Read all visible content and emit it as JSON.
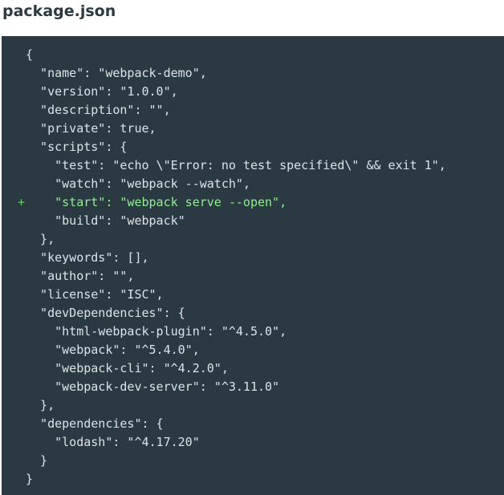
{
  "file": {
    "title": "package.json"
  },
  "code": {
    "lines": [
      {
        "marker": "",
        "text": "{",
        "added": false
      },
      {
        "marker": "",
        "text": "  \"name\": \"webpack-demo\",",
        "added": false
      },
      {
        "marker": "",
        "text": "  \"version\": \"1.0.0\",",
        "added": false
      },
      {
        "marker": "",
        "text": "  \"description\": \"\",",
        "added": false
      },
      {
        "marker": "",
        "text": "  \"private\": true,",
        "added": false
      },
      {
        "marker": "",
        "text": "  \"scripts\": {",
        "added": false
      },
      {
        "marker": "",
        "text": "    \"test\": \"echo \\\"Error: no test specified\\\" && exit 1\",",
        "added": false
      },
      {
        "marker": "",
        "text": "    \"watch\": \"webpack --watch\",",
        "added": false
      },
      {
        "marker": "+",
        "text": "    \"start\": \"webpack serve --open\",",
        "added": true
      },
      {
        "marker": "",
        "text": "    \"build\": \"webpack\"",
        "added": false
      },
      {
        "marker": "",
        "text": "  },",
        "added": false
      },
      {
        "marker": "",
        "text": "  \"keywords\": [],",
        "added": false
      },
      {
        "marker": "",
        "text": "  \"author\": \"\",",
        "added": false
      },
      {
        "marker": "",
        "text": "  \"license\": \"ISC\",",
        "added": false
      },
      {
        "marker": "",
        "text": "  \"devDependencies\": {",
        "added": false
      },
      {
        "marker": "",
        "text": "    \"html-webpack-plugin\": \"^4.5.0\",",
        "added": false
      },
      {
        "marker": "",
        "text": "    \"webpack\": \"^5.4.0\",",
        "added": false
      },
      {
        "marker": "",
        "text": "    \"webpack-cli\": \"^4.2.0\",",
        "added": false
      },
      {
        "marker": "",
        "text": "    \"webpack-dev-server\": \"^3.11.0\"",
        "added": false
      },
      {
        "marker": "",
        "text": "  },",
        "added": false
      },
      {
        "marker": "",
        "text": "  \"dependencies\": {",
        "added": false
      },
      {
        "marker": "",
        "text": "    \"lodash\": \"^4.17.20\"",
        "added": false
      },
      {
        "marker": "",
        "text": "  }",
        "added": false
      },
      {
        "marker": "",
        "text": "}",
        "added": false
      }
    ]
  },
  "colors": {
    "code_background": "#2b3a42",
    "code_text": "#dce3e8",
    "added_text": "#8df08d",
    "added_marker": "#5fd05f",
    "title_text": "#2b3a42"
  }
}
